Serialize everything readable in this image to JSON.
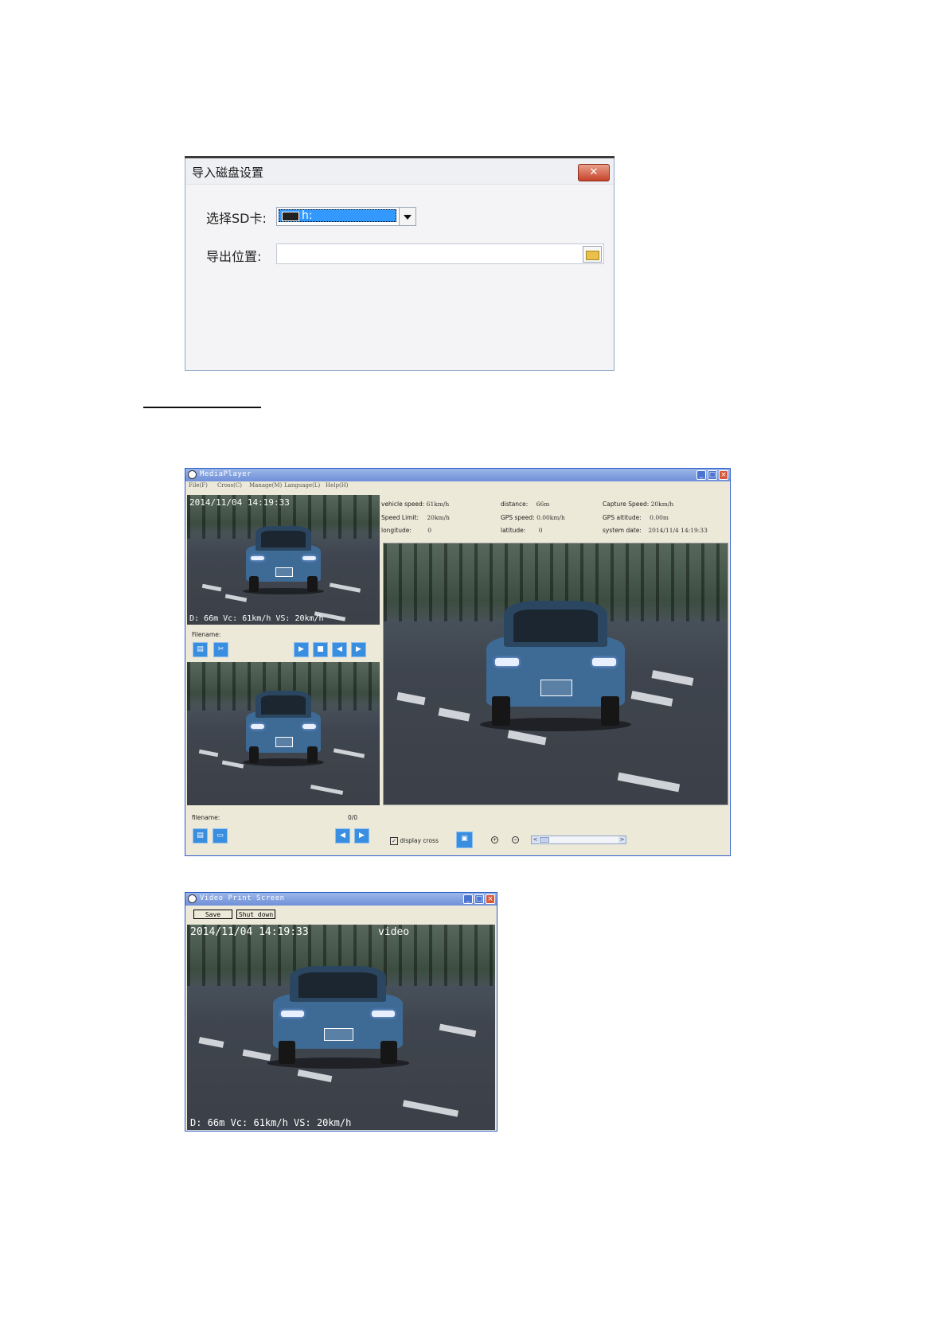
{
  "import_dialog": {
    "title": "导入磁盘设置",
    "close_label": "✕",
    "sd_label": "选择SD卡:",
    "sd_value": "h:",
    "export_label": "导出位置:",
    "export_value": ""
  },
  "media_player": {
    "title": "MediaPlayer",
    "menu": [
      "File(F)",
      "Cross(C)",
      "Manage(M)",
      "Language(L)",
      "Help(H)"
    ],
    "top_overlay_time": "2014/11/04 14:19:33",
    "top_overlay_stats": "D: 66m Vc: 61km/h VS: 20km/h",
    "filename_label_1": "Filename:",
    "filename_label_2": "filename:",
    "counter": "0/0",
    "info": {
      "vehicle_speed_label": "vehicle speed:",
      "vehicle_speed": "61km/h",
      "distance_label": "distance:",
      "distance": "66m",
      "capture_speed_label": "Capture Speed:",
      "capture_speed": "20km/h",
      "speed_limit_label": "Speed Limit:",
      "speed_limit": "20km/h",
      "gps_speed_label": "GPS speed:",
      "gps_speed": "0.00km/h",
      "gps_altitude_label": "GPS altitude:",
      "gps_altitude": "0.00m",
      "longitude_label": "longitude:",
      "longitude": "0",
      "latitude_label": "latitude:",
      "latitude": "0",
      "system_date_label": "system date:",
      "system_date": "2014/11/4 14:19:33"
    },
    "display_cross_label": "display cross",
    "display_cross_checked": true,
    "icons": {
      "play": "▶",
      "stop": "■",
      "prev": "◀",
      "next": "▶",
      "zoom_in": "+",
      "zoom_out": "−",
      "scroll_left": "<",
      "scroll_right": ">"
    }
  },
  "video_print_screen": {
    "title": "Video Print Screen",
    "save_label": "Save",
    "shutdown_label": "Shut down",
    "overlay_time": "2014/11/04 14:19:33",
    "overlay_mode": "video",
    "overlay_stats": "D: 66m Vc: 61km/h VS: 20km/h"
  },
  "colors": {
    "window_title": "#6f8fd8",
    "toolbar_button": "#3a8ee0",
    "selection": "#3399ff"
  }
}
